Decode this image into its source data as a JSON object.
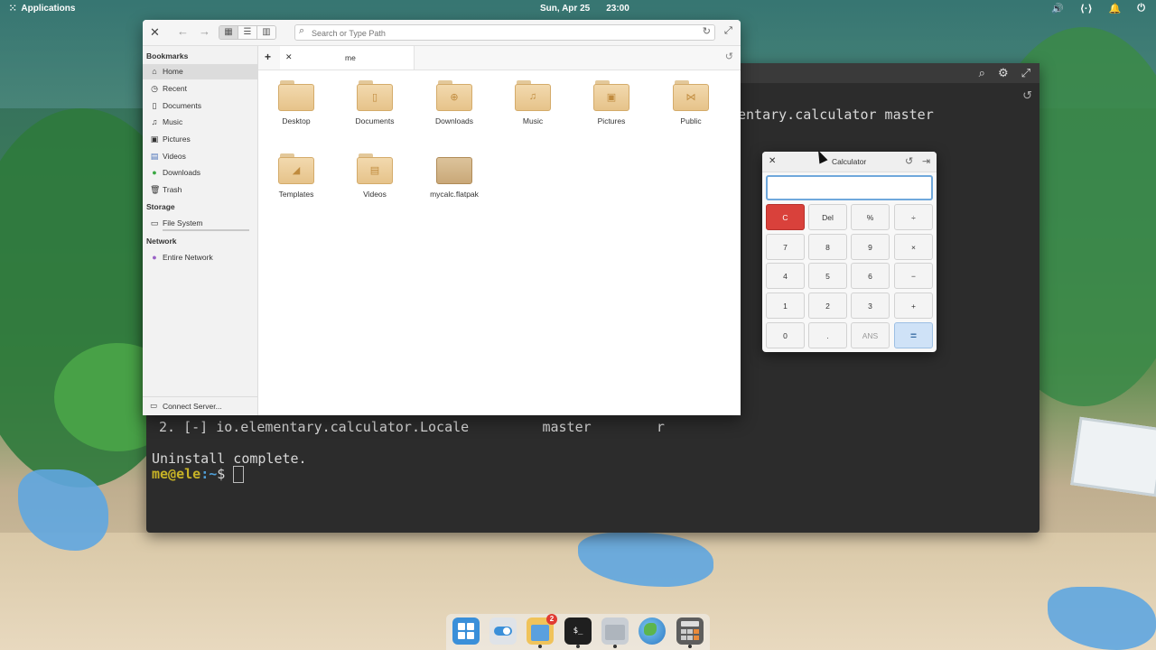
{
  "panel": {
    "applications_label": "Applications",
    "date": "Sun, Apr 25",
    "time": "23:00"
  },
  "terminal": {
    "visible_text_top": "entary.calculator master",
    "line_locale": "2. [-] io.elementary.calculator.Locale         master        r",
    "line_uninstall": "Uninstall complete.",
    "prompt_user": "me@ele",
    "prompt_path": ":~",
    "prompt_symbol": "$ "
  },
  "files": {
    "search_placeholder": "Search or Type Path",
    "tab_label": "me",
    "sidebar": {
      "bookmarks_heading": "Bookmarks",
      "bookmarks": [
        {
          "label": "Home",
          "icon": "home-icon"
        },
        {
          "label": "Recent",
          "icon": "clock-icon"
        },
        {
          "label": "Documents",
          "icon": "document-icon"
        },
        {
          "label": "Music",
          "icon": "music-icon"
        },
        {
          "label": "Pictures",
          "icon": "picture-icon"
        },
        {
          "label": "Videos",
          "icon": "video-icon"
        },
        {
          "label": "Downloads",
          "icon": "download-icon"
        },
        {
          "label": "Trash",
          "icon": "trash-icon"
        }
      ],
      "storage_heading": "Storage",
      "storage_item": "File System",
      "network_heading": "Network",
      "network_item": "Entire Network",
      "connect_server": "Connect Server..."
    },
    "items": [
      {
        "name": "Desktop",
        "emblem": ""
      },
      {
        "name": "Documents",
        "emblem": "▯"
      },
      {
        "name": "Downloads",
        "emblem": "⊕"
      },
      {
        "name": "Music",
        "emblem": "♫"
      },
      {
        "name": "Pictures",
        "emblem": "▣"
      },
      {
        "name": "Public",
        "emblem": "⋈"
      },
      {
        "name": "Templates",
        "emblem": "◢"
      },
      {
        "name": "Videos",
        "emblem": "▤"
      },
      {
        "name": "mycalc.flatpak",
        "emblem": ""
      }
    ]
  },
  "calculator": {
    "title": "Calculator",
    "display_value": "",
    "keys": [
      [
        "C",
        "Del",
        "%",
        "÷"
      ],
      [
        "7",
        "8",
        "9",
        "×"
      ],
      [
        "4",
        "5",
        "6",
        "−"
      ],
      [
        "1",
        "2",
        "3",
        "+"
      ],
      [
        "0",
        ".",
        "ANS",
        "="
      ]
    ],
    "accent_clear": "#d9413b",
    "accent_equals": "#cfe2f7"
  },
  "dock": {
    "badge_count": "2",
    "terminal_glyph": "$_"
  }
}
